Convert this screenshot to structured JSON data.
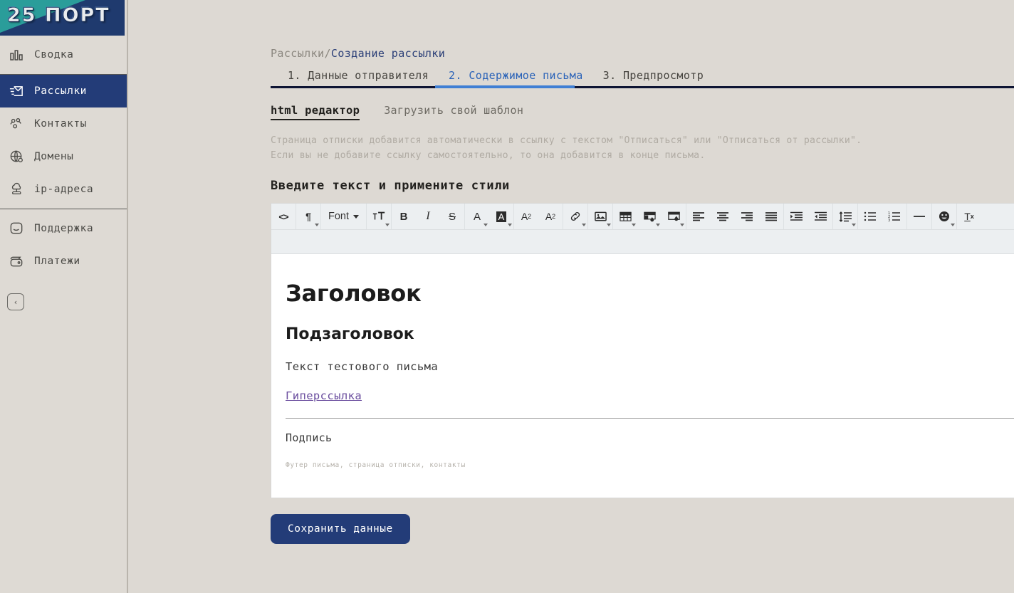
{
  "brand": {
    "logo_text": "25 ПОРТ",
    "teal": "#2a9d9a",
    "navy": "#1f3a6e"
  },
  "sidebar": {
    "groups": [
      {
        "items": [
          {
            "label": "Сводка",
            "icon": "chart-bars-icon",
            "active": false
          }
        ]
      },
      {
        "items": [
          {
            "label": "Рассылки",
            "icon": "mail-send-icon",
            "active": true
          },
          {
            "label": "Контакты",
            "icon": "people-icon",
            "active": false
          },
          {
            "label": "Домены",
            "icon": "globe-icon",
            "active": false
          },
          {
            "label": "ip-адреса",
            "icon": "cloud-network-icon",
            "active": false
          }
        ]
      },
      {
        "items": [
          {
            "label": "Поддержка",
            "icon": "chat-bubble-icon",
            "active": false
          },
          {
            "label": "Платежи",
            "icon": "wallet-icon",
            "active": false
          }
        ]
      }
    ],
    "collapse_icon": "chevron-left-icon",
    "active_color": "#233c78"
  },
  "breadcrumb": {
    "parent": "Рассылки/",
    "current": "Создание рассылки"
  },
  "tabs": [
    {
      "label": "1. Данные отправителя",
      "active": false
    },
    {
      "label": "2. Содержимое письма",
      "active": true
    },
    {
      "label": "3. Предпросмотр",
      "active": false
    }
  ],
  "panel": {
    "subtabs": {
      "html_editor": "html редактор",
      "upload_template": "Загрузить свой шаблон"
    },
    "notice_line1": "Страница отписки добавится автоматически в ссылку с текстом \"Отписаться\" или \"Отписаться от рассылки\".",
    "notice_line2": "Если вы не добавите ссылку самостоятельно, то она добавится в конце письма.",
    "section_title": "Введите текст и примените стили"
  },
  "toolbar": {
    "groups": [
      {
        "buttons": [
          {
            "name": "code-view-icon",
            "glyph": "<>",
            "caret": false
          }
        ]
      },
      {
        "buttons": [
          {
            "name": "paragraph-format-icon",
            "glyph": "¶",
            "caret": true
          }
        ]
      },
      {
        "buttons": [
          {
            "name": "font-family-dropdown",
            "glyph": "Font",
            "caret": true,
            "text": true
          }
        ]
      },
      {
        "buttons": [
          {
            "name": "font-size-icon",
            "glyph": "⊤T",
            "caret": true
          }
        ]
      },
      {
        "buttons": [
          {
            "name": "bold-icon",
            "glyph": "B",
            "caret": false
          },
          {
            "name": "italic-icon",
            "glyph": "I",
            "caret": false
          },
          {
            "name": "strikethrough-icon",
            "glyph": "S",
            "caret": false
          }
        ]
      },
      {
        "buttons": [
          {
            "name": "text-color-icon",
            "glyph": "A",
            "caret": true
          },
          {
            "name": "background-color-icon",
            "glyph": "A",
            "caret": true
          }
        ]
      },
      {
        "buttons": [
          {
            "name": "superscript-icon",
            "glyph": "A²",
            "caret": false
          },
          {
            "name": "subscript-icon",
            "glyph": "A₂",
            "caret": false
          }
        ]
      },
      {
        "buttons": [
          {
            "name": "insert-link-icon",
            "glyph": "link",
            "caret": true
          }
        ]
      },
      {
        "buttons": [
          {
            "name": "insert-image-icon",
            "glyph": "image",
            "caret": true
          }
        ]
      },
      {
        "buttons": [
          {
            "name": "insert-table-icon",
            "glyph": "table",
            "caret": true
          },
          {
            "name": "cell-background-icon",
            "glyph": "cell",
            "caret": true
          },
          {
            "name": "table-background-icon",
            "glyph": "tablebg",
            "caret": true
          }
        ]
      },
      {
        "buttons": [
          {
            "name": "align-left-icon",
            "glyph": "alignleft",
            "caret": false
          },
          {
            "name": "align-center-icon",
            "glyph": "aligncenter",
            "caret": false
          },
          {
            "name": "align-right-icon",
            "glyph": "alignright",
            "caret": false
          },
          {
            "name": "align-justify-icon",
            "glyph": "alignjustify",
            "caret": false
          }
        ]
      },
      {
        "buttons": [
          {
            "name": "indent-increase-icon",
            "glyph": "indent",
            "caret": false
          },
          {
            "name": "indent-decrease-icon",
            "glyph": "outdent",
            "caret": false
          }
        ]
      },
      {
        "buttons": [
          {
            "name": "line-height-icon",
            "glyph": "lineheight",
            "caret": true
          }
        ]
      },
      {
        "buttons": [
          {
            "name": "unordered-list-icon",
            "glyph": "ullist",
            "caret": false
          },
          {
            "name": "ordered-list-icon",
            "glyph": "ollist",
            "caret": false
          }
        ]
      },
      {
        "buttons": [
          {
            "name": "horizontal-rule-icon",
            "glyph": "hr",
            "caret": false
          }
        ]
      },
      {
        "buttons": [
          {
            "name": "emoticon-icon",
            "glyph": "emoji",
            "caret": true
          }
        ]
      },
      {
        "buttons": [
          {
            "name": "clear-formatting-icon",
            "glyph": "Tx",
            "caret": false
          }
        ]
      }
    ],
    "expand_icon": "fullscreen-icon"
  },
  "document": {
    "heading": "Заголовок",
    "subheading": "Подзаголовок",
    "body_text": "Текст тестового письма",
    "link_text": "Гиперссылка",
    "signature": "Подпись",
    "footer_note": "Футер письма, страница отписки, контакты",
    "link_color": "#6a4d9e"
  },
  "actions": {
    "save_label": "Сохранить данные"
  }
}
